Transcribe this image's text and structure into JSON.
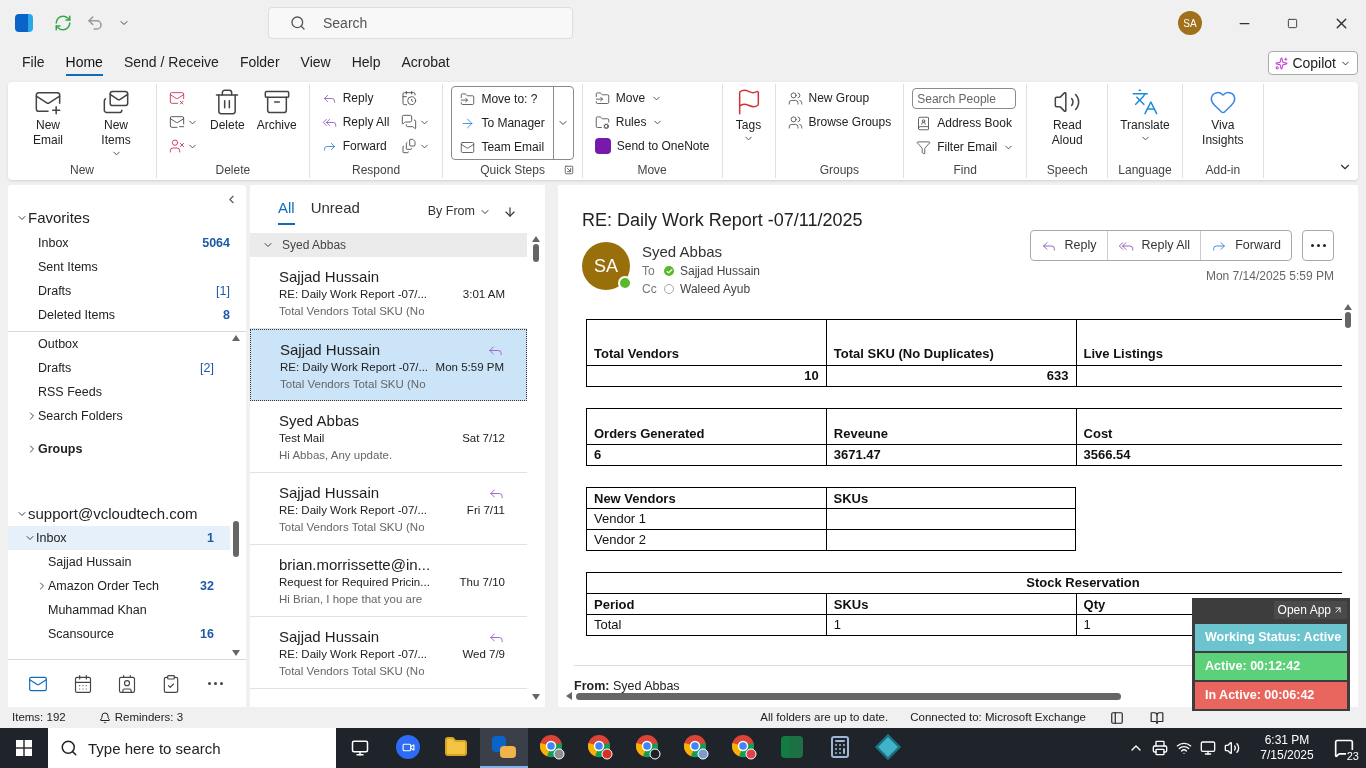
{
  "title_bar": {
    "search_placeholder": "Search",
    "avatar": "SA"
  },
  "menu_tabs": [
    {
      "label": "File",
      "selected": false
    },
    {
      "label": "Home",
      "selected": true
    },
    {
      "label": "Send / Receive",
      "selected": false
    },
    {
      "label": "Folder",
      "selected": false
    },
    {
      "label": "View",
      "selected": false
    },
    {
      "label": "Help",
      "selected": false
    },
    {
      "label": "Acrobat",
      "selected": false
    }
  ],
  "copilot": {
    "label": "Copilot"
  },
  "ribbon": [
    {
      "label": "New",
      "columns": [
        [
          {
            "kind": "large",
            "label": "New Email",
            "dropdown": false
          }
        ],
        [
          {
            "kind": "large",
            "label": "New Items",
            "dropdown": true
          }
        ]
      ]
    },
    {
      "label": "Delete",
      "columns": [
        [
          {
            "kind": "icon",
            "dropdown": false
          },
          {
            "kind": "icon",
            "dropdown": true
          },
          {
            "kind": "icon",
            "dropdown": true
          }
        ],
        [
          {
            "kind": "large",
            "label": "Delete",
            "dropdown": false
          }
        ],
        [
          {
            "kind": "large",
            "label": "Archive",
            "dropdown": false
          }
        ]
      ]
    },
    {
      "label": "Respond",
      "columns": [
        [
          {
            "kind": "small",
            "label": "Reply",
            "dropdown": false
          },
          {
            "kind": "small",
            "label": "Reply All",
            "dropdown": false
          },
          {
            "kind": "small",
            "label": "Forward",
            "dropdown": false
          }
        ],
        [
          {
            "kind": "icon",
            "dropdown": false
          },
          {
            "kind": "icon",
            "dropdown": true
          },
          {
            "kind": "icon",
            "dropdown": true
          }
        ]
      ]
    },
    {
      "label": "Quick Steps",
      "kind": "gallery",
      "columns": [
        [
          {
            "kind": "small",
            "label": "Move to: ?",
            "dropdown": false
          },
          {
            "kind": "small",
            "label": "To Manager",
            "dropdown": false
          },
          {
            "kind": "small",
            "label": "Team Email",
            "dropdown": false
          }
        ]
      ]
    },
    {
      "label": "Move",
      "columns": [
        [
          {
            "kind": "small",
            "label": "Move",
            "dropdown": true
          },
          {
            "kind": "small",
            "label": "Rules",
            "dropdown": true
          },
          {
            "kind": "small",
            "label": "Send to OneNote",
            "dropdown": false
          }
        ]
      ]
    },
    {
      "columns": [
        [
          {
            "kind": "large",
            "label": "Tags",
            "dropdown": true
          }
        ]
      ]
    },
    {
      "label": "Groups",
      "columns": [
        [
          {
            "kind": "small",
            "label": "New Group",
            "dropdown": false
          },
          {
            "kind": "small",
            "label": "Browse Groups",
            "dropdown": false
          }
        ]
      ]
    },
    {
      "label": "Find",
      "columns": [
        [
          {
            "kind": "search",
            "placeholder": "Search People"
          },
          {
            "kind": "small",
            "label": "Address Book",
            "dropdown": false
          },
          {
            "kind": "small",
            "label": "Filter Email",
            "dropdown": true
          }
        ]
      ]
    },
    {
      "label": "Speech",
      "columns": [
        [
          {
            "kind": "large",
            "label": "Read Aloud",
            "dropdown": false
          }
        ]
      ]
    },
    {
      "label": "Language",
      "columns": [
        [
          {
            "kind": "large",
            "label": "Translate",
            "dropdown": true
          }
        ]
      ]
    },
    {
      "label": "Add-in",
      "columns": [
        [
          {
            "kind": "large",
            "label": "Viva Insights",
            "dropdown": false
          }
        ]
      ]
    }
  ],
  "folder_pane": {
    "favorites": {
      "title": "Favorites",
      "expanded": true,
      "items": [
        {
          "label": "Inbox",
          "count": "5064",
          "unread": true,
          "selected": false
        },
        {
          "label": "Sent Items",
          "selected": false
        },
        {
          "label": "Drafts",
          "count": "[1]",
          "unread": false,
          "selected": false
        },
        {
          "label": "Deleted Items",
          "count": "8",
          "unread": true,
          "selected": false
        }
      ]
    },
    "folders": [
      {
        "label": "Outbox",
        "selected": false
      },
      {
        "label": "Drafts",
        "count": "[2]",
        "unread": false,
        "selected": false
      },
      {
        "label": "RSS Feeds",
        "selected": false
      },
      {
        "label": "Search Folders",
        "expanded": false,
        "selected": false
      }
    ],
    "groups": {
      "label": "Groups",
      "expanded": false
    },
    "account": {
      "title": "support@vcloudtech.com",
      "expanded": true,
      "items": [
        {
          "label": "Inbox",
          "count": "1",
          "unread": true,
          "expanded": true,
          "selected": true,
          "children": [
            {
              "label": "Sajjad Hussain",
              "selected": false
            },
            {
              "label": "Amazon Order Tech",
              "count": "32",
              "unread": true,
              "expanded": false,
              "selected": false
            },
            {
              "label": "Muhammad Khan",
              "selected": false
            },
            {
              "label": "Scansource",
              "count": "16",
              "unread": true,
              "selected": false
            }
          ]
        }
      ]
    },
    "nav": [
      {
        "kind": "mail",
        "selected": true
      },
      {
        "kind": "calendar",
        "selected": false
      },
      {
        "kind": "people",
        "selected": false
      },
      {
        "kind": "tasks",
        "selected": false
      },
      {
        "kind": "more",
        "selected": false
      }
    ]
  },
  "message_list": {
    "filters": [
      {
        "label": "All",
        "selected": true
      },
      {
        "label": "Unread",
        "selected": false
      }
    ],
    "sort": "By From",
    "group": {
      "label": "Syed Abbas",
      "expanded": true
    },
    "messages": [
      {
        "sender": "Sajjad Hussain",
        "subject": "RE: Daily Work Report -07/...",
        "preview": "Total Vendors  Total SKU (No",
        "time": "3:01 AM",
        "replied": false,
        "selected": false
      },
      {
        "sender": "Sajjad Hussain",
        "subject": "RE: Daily Work Report -07/...",
        "preview": "Total Vendors  Total SKU (No",
        "time": "Mon 5:59 PM",
        "replied": true,
        "selected": true
      },
      {
        "sender": "Syed Abbas",
        "subject": "Test Mail",
        "preview": "Hi Abbas,  Any update.",
        "time": "Sat 7/12",
        "replied": false,
        "selected": false
      },
      {
        "sender": "Sajjad Hussain",
        "subject": "RE: Daily Work Report -07/...",
        "preview": "Total Vendors  Total SKU (No",
        "time": "Fri 7/11",
        "replied": true,
        "selected": false
      },
      {
        "sender": "brian.morrissette@in...",
        "subject": "Request for Required Pricin...",
        "preview": "Hi Brian,  I hope that you are",
        "time": "Thu 7/10",
        "replied": false,
        "selected": false
      },
      {
        "sender": "Sajjad Hussain",
        "subject": "RE: Daily Work Report -07/...",
        "preview": "Total Vendors  Total SKU (No",
        "time": "Wed 7/9",
        "replied": true,
        "selected": false
      }
    ]
  },
  "reading_pane": {
    "subject": "RE: Daily Work Report -07/11/2025",
    "sender": "Syed Abbas",
    "avatar": "SA",
    "to_label": "To",
    "to": {
      "name": "Sajjad Hussain",
      "online": true
    },
    "cc_label": "Cc",
    "cc": {
      "name": "Waleed Ayub",
      "online": false
    },
    "actions": [
      {
        "label": "Reply"
      },
      {
        "label": "Reply All"
      },
      {
        "label": "Forward"
      }
    ],
    "date": "Mon 7/14/2025 5:59 PM",
    "tables": [
      {
        "kind": "totals",
        "columns": [
          "Total Vendors",
          "Total SKU (No Duplicates)",
          "Live Listings"
        ],
        "rows": [
          [
            "10",
            "633"
          ]
        ]
      },
      {
        "kind": "metrics",
        "columns": [
          "Orders Generated",
          "Reveune",
          "Cost"
        ],
        "rows": [
          [
            "6",
            "3671.47",
            "3566.54"
          ]
        ]
      },
      {
        "kind": "list",
        "columns": [
          "New Vendors",
          "SKUs"
        ],
        "rows": [
          [
            "Vendor 1"
          ],
          [
            "Vendor 2"
          ]
        ]
      },
      {
        "kind": "reservation",
        "title": "Stock Reservation",
        "columns": [
          "Period",
          "SKUs",
          "Qty"
        ],
        "rows": [
          [
            "Total",
            "1",
            "1"
          ]
        ]
      }
    ],
    "from_line": "**From:** Syed Abbas"
  },
  "tracker": {
    "open_label": "Open App",
    "items": [
      {
        "label": "Working Status: Active",
        "color": "#6cc4cf"
      },
      {
        "label": "Active: 00:12:42",
        "color": "#5dd07a"
      },
      {
        "label": "In Active: 00:06:42",
        "color": "#e8665e"
      }
    ]
  },
  "status_bar": {
    "items": "Items: 192",
    "reminders": "Reminders: 3",
    "sync": "All folders are up to date.",
    "connection": "Connected to: Microsoft Exchange"
  },
  "taskbar": {
    "search_placeholder": "Type here to search",
    "apps": [
      {
        "kind": "zoom",
        "active": false
      },
      {
        "kind": "explorer",
        "active": false
      },
      {
        "kind": "outlook",
        "active": true
      },
      {
        "kind": "chrome",
        "color": "#8e8e8e",
        "active": false
      },
      {
        "kind": "chrome",
        "color": "#d93025",
        "active": false
      },
      {
        "kind": "chrome",
        "color": "#202124",
        "active": false
      },
      {
        "kind": "chrome",
        "color": "#7b9ad0",
        "active": false
      },
      {
        "kind": "chrome",
        "color": "#e04050",
        "active": false
      },
      {
        "kind": "excel",
        "active": false
      },
      {
        "kind": "calculator",
        "active": false
      },
      {
        "kind": "diamond",
        "active": false
      }
    ],
    "time": "6:31 PM",
    "date": "7/15/2025",
    "notifications": "23"
  }
}
